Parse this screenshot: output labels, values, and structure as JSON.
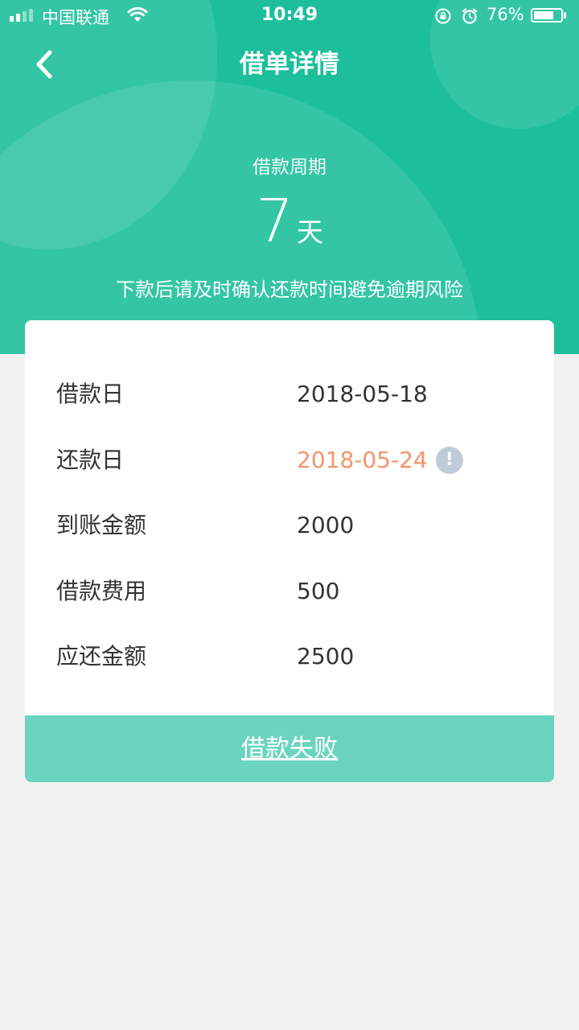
{
  "status_bar": {
    "carrier": "中国联通",
    "time": "10:49",
    "battery": "76%",
    "battery_level": 0.76
  },
  "header": {
    "title": "借单详情",
    "back_icon": "chevron-left-icon"
  },
  "period": {
    "label": "借款周期",
    "value": "7",
    "unit": "天",
    "notice": "下款后请及时确认还款时间避免逾期风险"
  },
  "details": [
    {
      "label": "借款日",
      "value": "2018-05-18"
    },
    {
      "label": "还款日",
      "value": "2018-05-24",
      "highlight": true
    },
    {
      "label": "到账金额",
      "value": "2000"
    },
    {
      "label": "借款费用",
      "value": "500"
    },
    {
      "label": "应还金额",
      "value": "2500"
    }
  ],
  "info_icon_text": "!",
  "status_button": {
    "label": "借款失败"
  },
  "colors": {
    "primary": "#1dbf9b",
    "button": "#6bd4bf",
    "highlight": "#f4946a",
    "background": "#f2f2f2"
  }
}
